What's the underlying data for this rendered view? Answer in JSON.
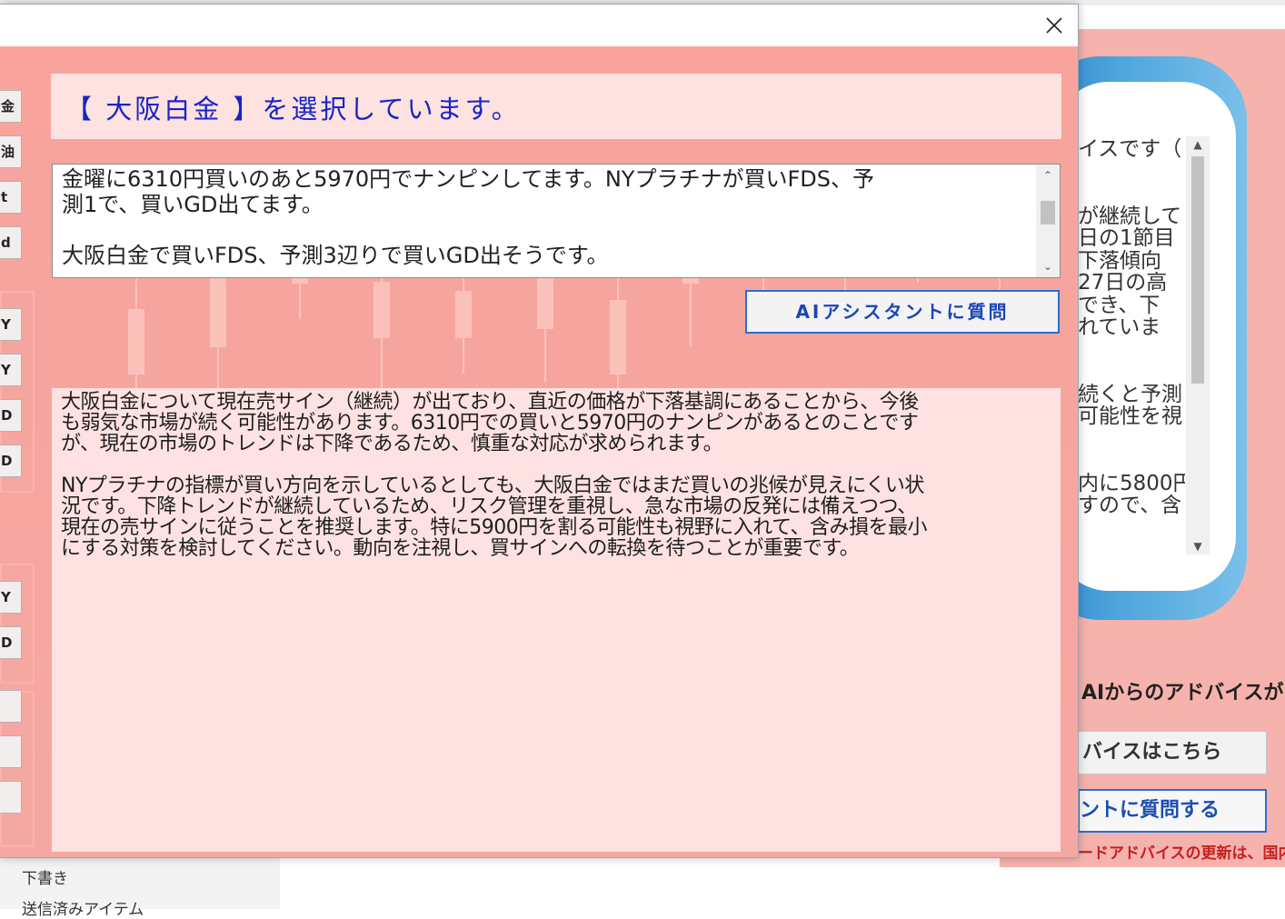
{
  "dialog": {
    "close_icon": "close-icon",
    "header": "【 大阪白金 】を選択しています。",
    "memo_text": "金曜に6310円買いのあと5970円でナンピンしてます。NYプラチナが買いFDS、予\n測1で、買いGD出てます。\n\n大阪白金で買いFDS、予測3辺りで買いGD出そうです。",
    "ai_button_label": "AIアシスタントに質問",
    "response_text": "大阪白金について現在売サイン（継続）が出ており、直近の価格が下落基調にあることから、今後\nも弱気な市場が続く可能性があります。6310円での買いと5970円のナンピンがあるとのことです\nが、現在の市場のトレンドは下降であるため、慎重な対応が求められます。\n\nNYプラチナの指標が買い方向を示しているとしても、大阪白金ではまだ買いの兆候が見えにくい状\n況です。下降トレンドが継続しているため、リスク管理を重視し、急な市場の反発には備えつつ、\n現在の売サインに従うことを推奨します。特に5900円を割る可能性も視野に入れて、含み損を最小\nにする対策を検討してください。動向を注視し、買サインへの転換を待つことが重要です。",
    "left_strip_labels": [
      "金",
      "油",
      "t",
      "d",
      "Y",
      "Y",
      "D",
      "D",
      "Y",
      "D",
      "",
      "",
      ""
    ]
  },
  "background_app": {
    "panel_lines": [
      "イスです（",
      "",
      "",
      "が継続して",
      "日の1節目",
      "下落傾向",
      "27日の高",
      "でき、下",
      "れていま",
      "",
      "",
      "続くと予測",
      "可能性を視",
      "",
      "",
      "内に5800円",
      "すので、含"
    ],
    "ai_label": "AIからのアドバイスが",
    "advice_button": "バイスはこちら",
    "ask_button": "ントに質問する",
    "footer": "ードアドバイスの更新は、国内"
  },
  "mail": {
    "items": [
      "下書き",
      "送信済みアイテム"
    ]
  },
  "colors": {
    "dialog_bg": "#f8a49d",
    "header_text": "#1a24c4",
    "button_border": "#2a6fd0",
    "footer_red": "#c62020"
  }
}
